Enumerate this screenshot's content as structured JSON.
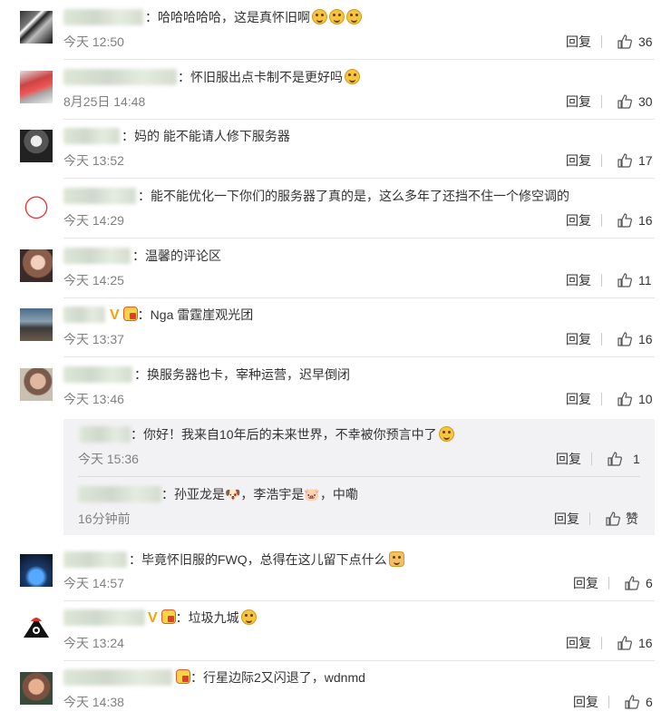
{
  "reply_label": "回复",
  "comments": [
    {
      "text": "：哈哈哈哈哈，这是真怀旧啊",
      "time": "今天 12:50",
      "likes": "36"
    },
    {
      "text": "：怀旧服出点卡制不是更好吗",
      "time": "8月25日 14:48",
      "likes": "30"
    },
    {
      "text": "：妈的 能不能请人修下服务器",
      "time": "今天 13:52",
      "likes": "17"
    },
    {
      "text": "：能不能优化一下你们的服务器了真的是，这么多年了还挡不住一个修空调的",
      "time": "今天 14:29",
      "likes": "16"
    },
    {
      "text": "：温馨的评论区",
      "time": "今天 14:25",
      "likes": "11"
    },
    {
      "text": "：Nga 雷霆崖观光团",
      "time": "今天 13:37",
      "likes": "16"
    },
    {
      "text": "：换服务器也卡，宰种运营，迟早倒闭",
      "time": "今天 13:46",
      "likes": "10"
    },
    {
      "text": "：毕竟怀旧服的FWQ，总得在这儿留下点什么",
      "time": "今天 14:57",
      "likes": "6"
    },
    {
      "text": "：垃圾九城",
      "time": "今天 13:24",
      "likes": "16"
    },
    {
      "text": "：行星边际2又闪退了，wdnmd",
      "time": "今天 14:38",
      "likes": "6"
    }
  ],
  "replies": [
    {
      "text": "：你好！我来自10年后的未来世界，不幸被你预言中了",
      "time": "今天 15:36",
      "likes": "1"
    },
    {
      "text": "：孙亚龙是🐶，李浩宇是🐷，中嘞",
      "time": "16分钟前",
      "likes": "赞"
    }
  ]
}
